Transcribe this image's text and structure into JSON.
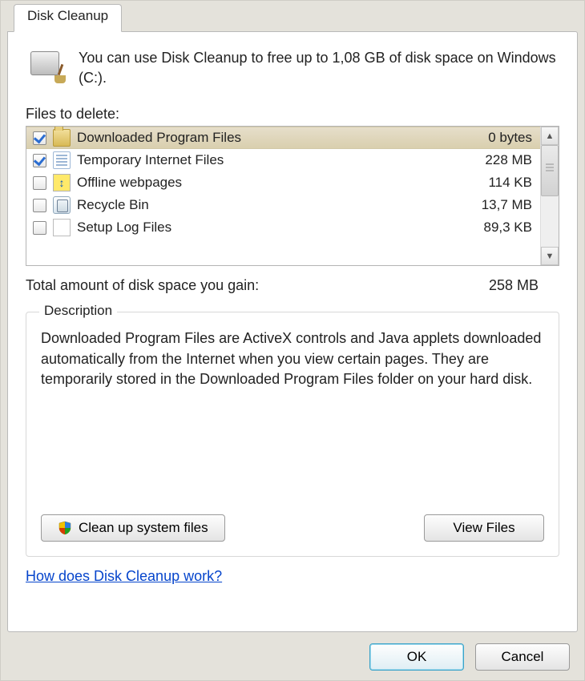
{
  "tab_label": "Disk Cleanup",
  "intro_text": "You can use Disk Cleanup to free up to 1,08 GB of disk space on Windows  (C:).",
  "files_label": "Files to delete:",
  "files": [
    {
      "name": "Downloaded Program Files",
      "size": "0 bytes",
      "checked": true,
      "selected": true,
      "icon": "folder"
    },
    {
      "name": "Temporary Internet Files",
      "size": "228 MB",
      "checked": true,
      "selected": false,
      "icon": "doc"
    },
    {
      "name": "Offline webpages",
      "size": "114 KB",
      "checked": false,
      "selected": false,
      "icon": "web"
    },
    {
      "name": "Recycle Bin",
      "size": "13,7 MB",
      "checked": false,
      "selected": false,
      "icon": "bin"
    },
    {
      "name": "Setup Log Files",
      "size": "89,3 KB",
      "checked": false,
      "selected": false,
      "icon": "page"
    }
  ],
  "total_label": "Total amount of disk space you gain:",
  "total_value": "258 MB",
  "description_legend": "Description",
  "description_text": "Downloaded Program Files are ActiveX controls and Java applets downloaded automatically from the Internet when you view certain pages. They are temporarily stored in the Downloaded Program Files folder on your hard disk.",
  "buttons": {
    "cleanup_system": "Clean up system files",
    "view_files": "View Files",
    "ok": "OK",
    "cancel": "Cancel"
  },
  "help_link": "How does Disk Cleanup work?"
}
